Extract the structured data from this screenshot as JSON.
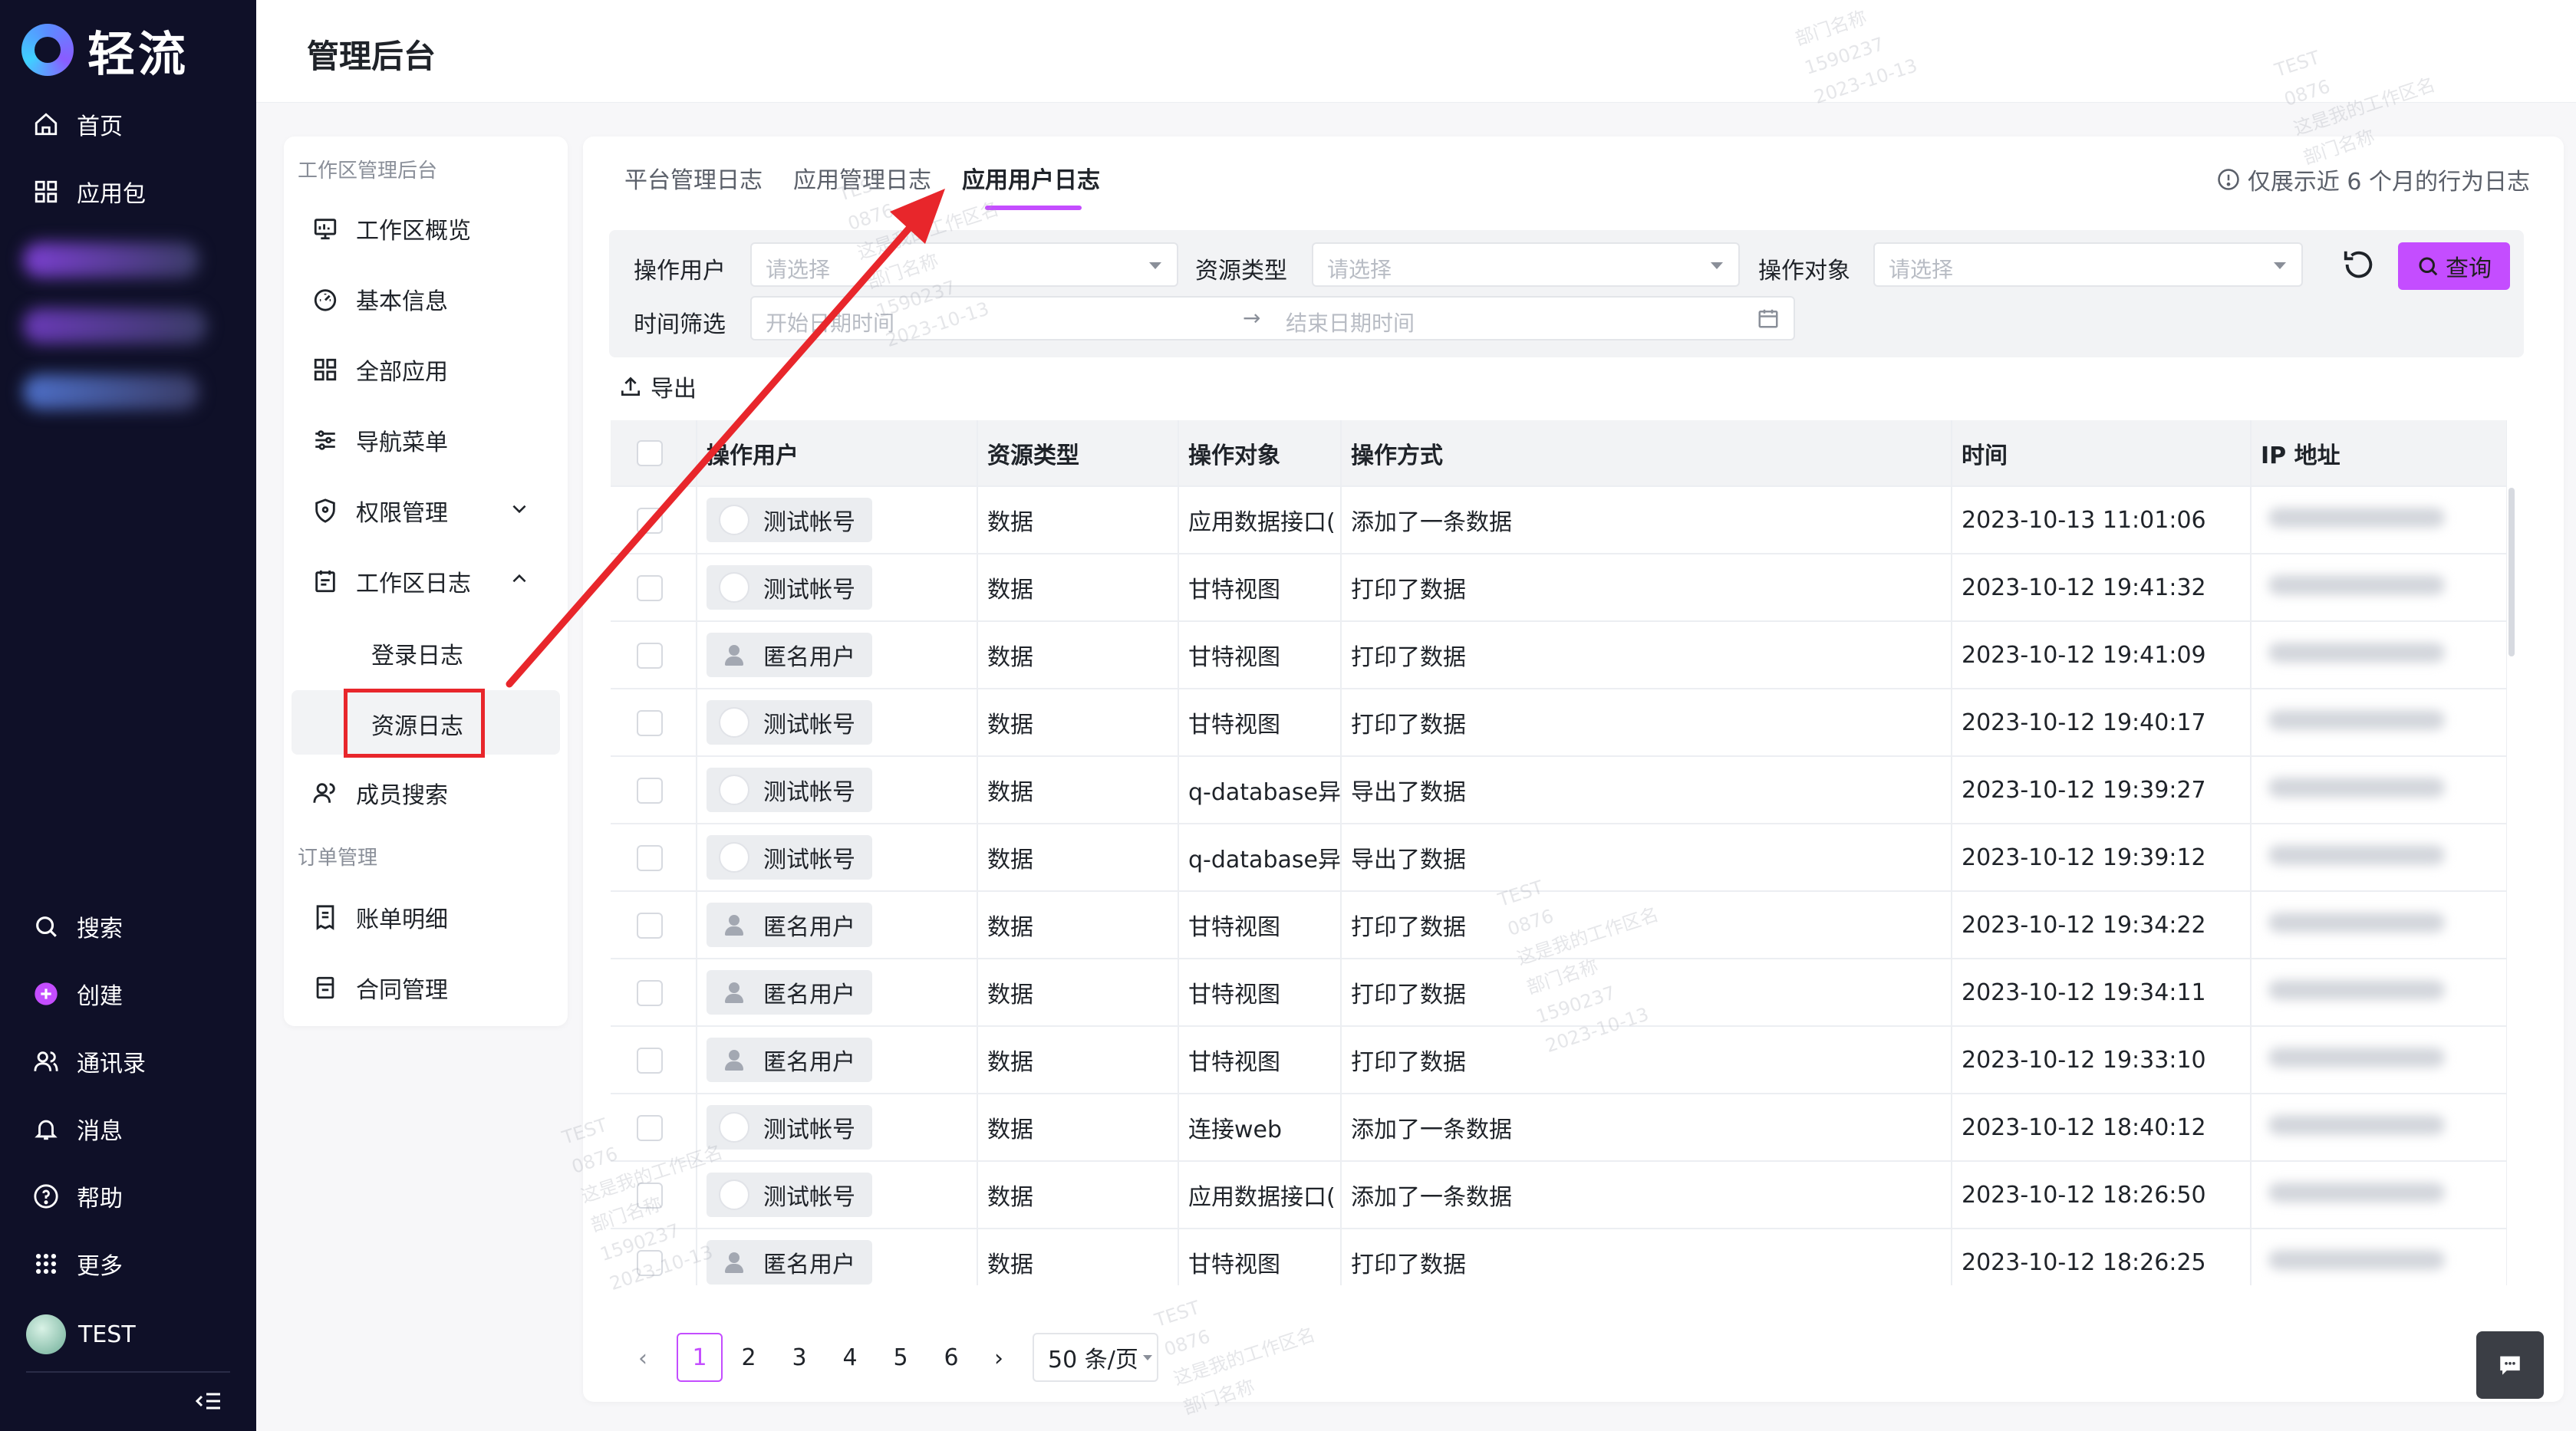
{
  "app": {
    "name": "轻流"
  },
  "sidebar": {
    "items": [
      {
        "label": "首页",
        "icon": "home-icon"
      },
      {
        "label": "应用包",
        "icon": "grid-icon"
      }
    ],
    "bottom_items": [
      {
        "label": "搜索",
        "icon": "search-icon"
      },
      {
        "label": "创建",
        "icon": "plus-circle-icon"
      },
      {
        "label": "通讯录",
        "icon": "contacts-icon"
      },
      {
        "label": "消息",
        "icon": "bell-icon"
      },
      {
        "label": "帮助",
        "icon": "help-icon"
      },
      {
        "label": "更多",
        "icon": "dots-grid-icon"
      }
    ],
    "user": {
      "name": "TEST"
    }
  },
  "header": {
    "title": "管理后台"
  },
  "menu": {
    "group1": "工作区管理后台",
    "items": [
      {
        "label": "工作区概览",
        "icon": "overview-icon"
      },
      {
        "label": "基本信息",
        "icon": "dashboard-icon"
      },
      {
        "label": "全部应用",
        "icon": "apps-icon"
      },
      {
        "label": "导航菜单",
        "icon": "sliders-icon"
      },
      {
        "label": "权限管理",
        "icon": "shield-icon"
      },
      {
        "label": "工作区日志",
        "icon": "calendar-icon"
      }
    ],
    "log_sub_items": [
      "登录日志",
      "资源日志"
    ],
    "member_search": {
      "label": "成员搜索",
      "icon": "users-icon"
    },
    "group2": "订单管理",
    "order_items": [
      {
        "label": "账单明细",
        "icon": "bill-icon"
      },
      {
        "label": "合同管理",
        "icon": "contract-icon"
      }
    ]
  },
  "tabs": [
    "平台管理日志",
    "应用管理日志",
    "应用用户日志"
  ],
  "active_tab": "应用用户日志",
  "notice": "仅展示近 6 个月的行为日志",
  "filters": {
    "user_label": "操作用户",
    "user_placeholder": "请选择",
    "resource_label": "资源类型",
    "resource_placeholder": "请选择",
    "object_label": "操作对象",
    "object_placeholder": "请选择",
    "time_label": "时间筛选",
    "start_placeholder": "开始日期时间",
    "end_placeholder": "结束日期时间",
    "query_label": "查询"
  },
  "export_label": "导出",
  "table": {
    "columns": [
      "操作用户",
      "资源类型",
      "操作对象",
      "操作方式",
      "时间",
      "IP 地址"
    ],
    "rows": [
      {
        "user": "测试帐号",
        "anon": false,
        "type": "数据",
        "object": "应用数据接口(",
        "action": "添加了一条数据",
        "time": "2023-10-13 11:01:06"
      },
      {
        "user": "测试帐号",
        "anon": false,
        "type": "数据",
        "object": "甘特视图",
        "action": "打印了数据",
        "time": "2023-10-12 19:41:32"
      },
      {
        "user": "匿名用户",
        "anon": true,
        "type": "数据",
        "object": "甘特视图",
        "action": "打印了数据",
        "time": "2023-10-12 19:41:09"
      },
      {
        "user": "测试帐号",
        "anon": false,
        "type": "数据",
        "object": "甘特视图",
        "action": "打印了数据",
        "time": "2023-10-12 19:40:17"
      },
      {
        "user": "测试帐号",
        "anon": false,
        "type": "数据",
        "object": "q-database异",
        "action": "导出了数据",
        "time": "2023-10-12 19:39:27"
      },
      {
        "user": "测试帐号",
        "anon": false,
        "type": "数据",
        "object": "q-database异",
        "action": "导出了数据",
        "time": "2023-10-12 19:39:12"
      },
      {
        "user": "匿名用户",
        "anon": true,
        "type": "数据",
        "object": "甘特视图",
        "action": "打印了数据",
        "time": "2023-10-12 19:34:22"
      },
      {
        "user": "匿名用户",
        "anon": true,
        "type": "数据",
        "object": "甘特视图",
        "action": "打印了数据",
        "time": "2023-10-12 19:34:11"
      },
      {
        "user": "匿名用户",
        "anon": true,
        "type": "数据",
        "object": "甘特视图",
        "action": "打印了数据",
        "time": "2023-10-12 19:33:10"
      },
      {
        "user": "测试帐号",
        "anon": false,
        "type": "数据",
        "object": "连接web",
        "action": "添加了一条数据",
        "time": "2023-10-12 18:40:12"
      },
      {
        "user": "测试帐号",
        "anon": false,
        "type": "数据",
        "object": "应用数据接口(",
        "action": "添加了一条数据",
        "time": "2023-10-12 18:26:50"
      },
      {
        "user": "匿名用户",
        "anon": true,
        "type": "数据",
        "object": "甘特视图",
        "action": "打印了数据",
        "time": "2023-10-12 18:26:25"
      }
    ]
  },
  "pagination": {
    "pages": [
      "1",
      "2",
      "3",
      "4",
      "5",
      "6"
    ],
    "current": "1",
    "page_size": "50 条/页"
  },
  "colors": {
    "accent": "#c44dff",
    "sidebar_bg": "#0f1028",
    "annotation": "#e8262b"
  }
}
